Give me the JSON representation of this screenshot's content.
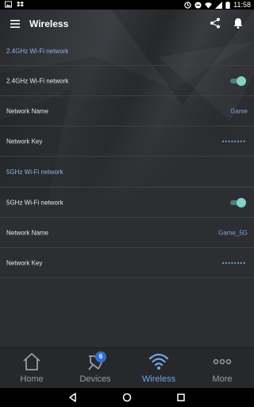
{
  "status_bar": {
    "time": "11:58",
    "icons": [
      "image-icon",
      "dropbox-icon",
      "sync-icon",
      "minus-circle-icon",
      "wifi-icon",
      "signal-icon",
      "battery-icon"
    ]
  },
  "header": {
    "title": "Wireless",
    "icons": [
      "menu-icon",
      "share-icon",
      "bell-icon"
    ]
  },
  "sections": [
    {
      "title": "2.4GHz Wi-Fi network",
      "toggle_label": "2.4GHz Wi-Fi network",
      "toggle_on": true,
      "network_name_label": "Network Name",
      "network_name_value": "Game",
      "network_key_label": "Network Key",
      "network_key_value": "••••••••"
    },
    {
      "title": "5GHz Wi-Fi network",
      "toggle_label": "5GHz Wi-Fi network",
      "toggle_on": true,
      "network_name_label": "Network Name",
      "network_name_value": "Game_5G",
      "network_key_label": "Network Key",
      "network_key_value": "••••••••"
    }
  ],
  "tabbar": {
    "tabs": [
      {
        "label": "Home",
        "icon": "home-icon",
        "active": false
      },
      {
        "label": "Devices",
        "icon": "devices-icon",
        "active": false,
        "badge": "6"
      },
      {
        "label": "Wireless",
        "icon": "wifi-icon",
        "active": true
      },
      {
        "label": "More",
        "icon": "more-icon",
        "active": false
      }
    ]
  },
  "colors": {
    "accent": "#6fa7e8",
    "toggle_on": "#7fd4c6",
    "background": "#2c2e31",
    "badge": "#2f6fd1"
  }
}
